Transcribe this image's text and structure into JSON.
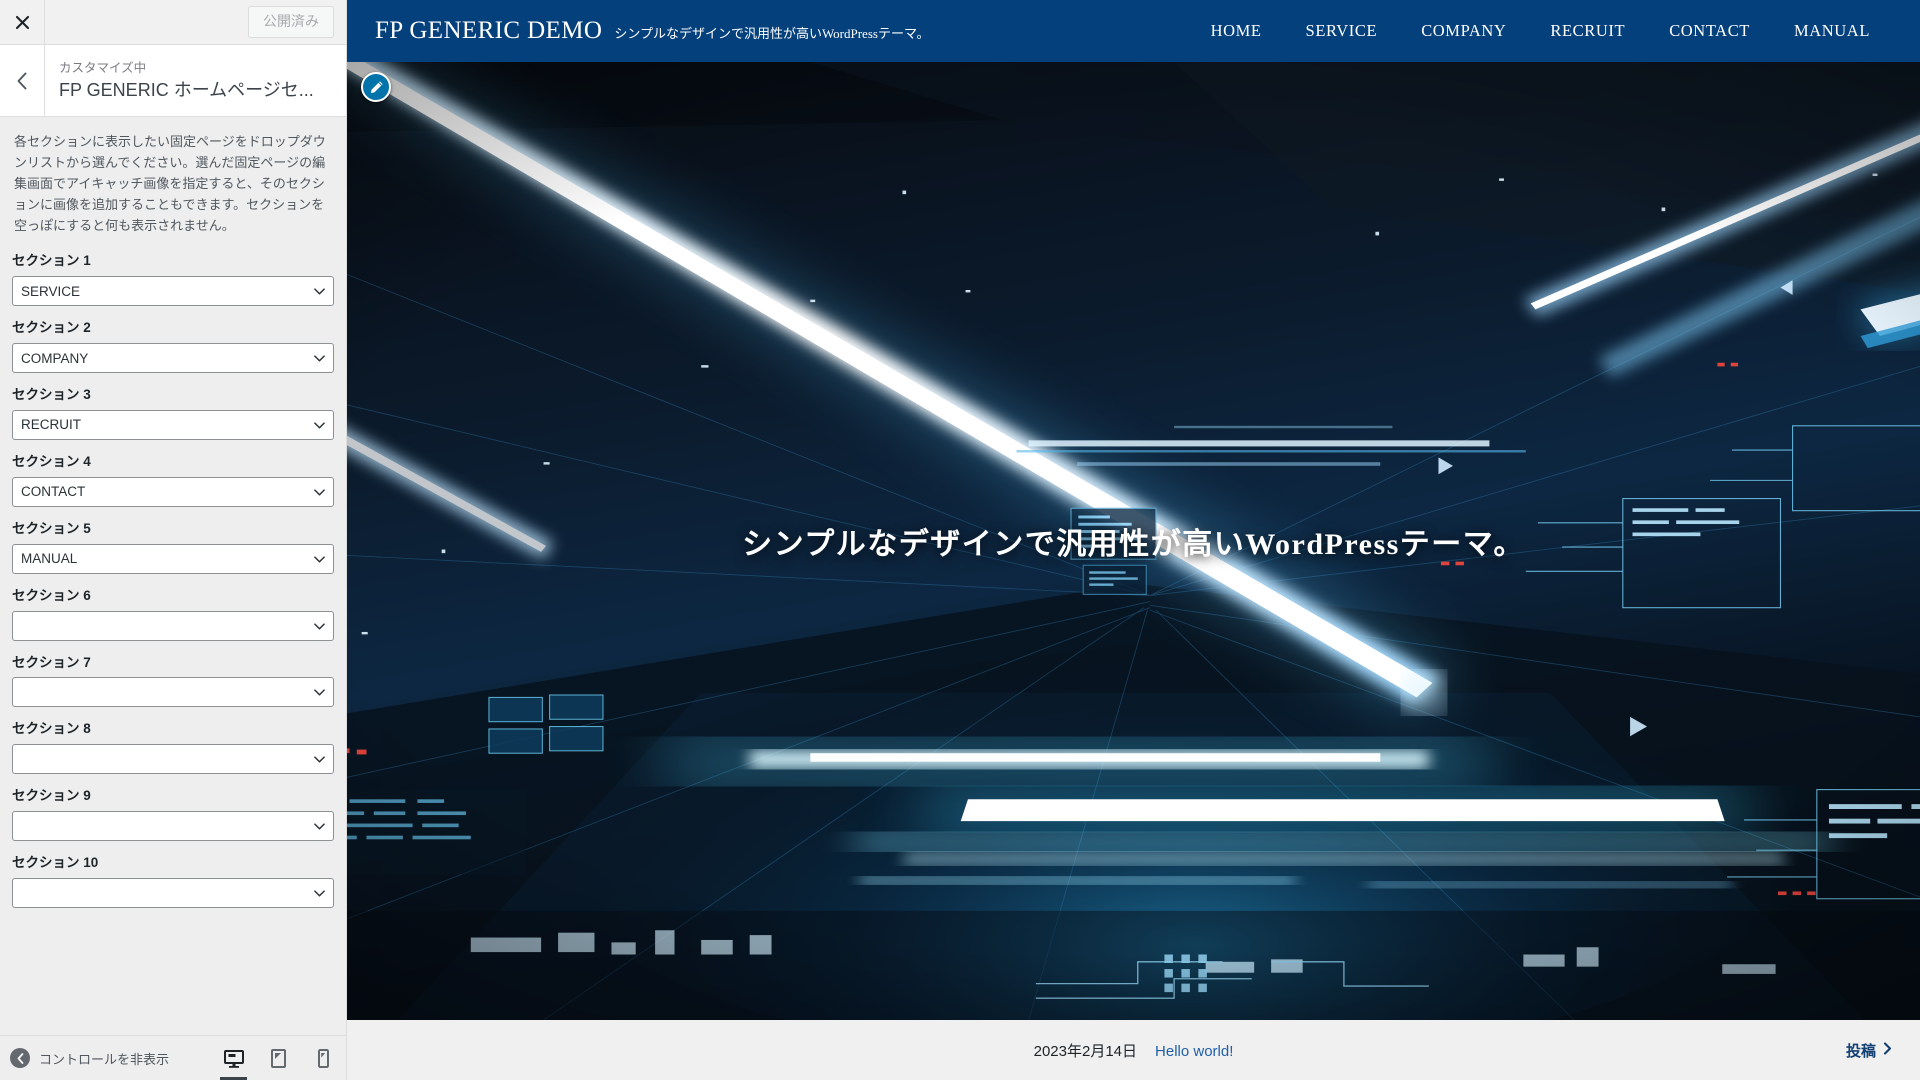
{
  "customizer": {
    "close_icon": "close-icon",
    "publish_label": "公開済み",
    "back_icon": "chevron-left-icon",
    "eyebrow": "カスタマイズ中",
    "panel_name": "FP GENERIC ホームページセ...",
    "description": "各セクションに表示したい固定ページをドロップダウンリストから選んでください。選んだ固定ページの編集画面でアイキャッチ画像を指定すると、そのセクションに画像を追加することもできます。セクションを空っぽにすると何も表示されません。",
    "sections": [
      {
        "label": "セクション 1",
        "value": "SERVICE"
      },
      {
        "label": "セクション 2",
        "value": "COMPANY"
      },
      {
        "label": "セクション 3",
        "value": "RECRUIT"
      },
      {
        "label": "セクション 4",
        "value": "CONTACT"
      },
      {
        "label": "セクション 5",
        "value": "MANUAL"
      },
      {
        "label": "セクション 6",
        "value": ""
      },
      {
        "label": "セクション 7",
        "value": ""
      },
      {
        "label": "セクション 8",
        "value": ""
      },
      {
        "label": "セクション 9",
        "value": ""
      },
      {
        "label": "セクション 10",
        "value": ""
      }
    ],
    "footer": {
      "collapse_label": "コントロールを非表示",
      "collapse_icon": "chevron-left-circle-icon",
      "devices": [
        {
          "name": "desktop",
          "icon": "desktop-icon",
          "active": true
        },
        {
          "name": "tablet",
          "icon": "tablet-icon",
          "active": false
        },
        {
          "name": "mobile",
          "icon": "mobile-icon",
          "active": false
        }
      ]
    }
  },
  "preview": {
    "site": {
      "title": "FP GENERIC DEMO",
      "tagline": "シンプルなデザインで汎用性が高いWordPressテーマ。",
      "header_bg": "#04407c",
      "nav": [
        {
          "label": "HOME"
        },
        {
          "label": "SERVICE"
        },
        {
          "label": "COMPANY"
        },
        {
          "label": "RECRUIT"
        },
        {
          "label": "CONTACT"
        },
        {
          "label": "MANUAL"
        }
      ]
    },
    "edit_shortcut_icon": "pencil-icon",
    "hero": {
      "heading": "シンプルなデザインで汎用性が高いWordPressテーマ。",
      "image_description": "dark blue futuristic data-center corridor with glowing light streaks"
    },
    "footer": {
      "post_date": "2023年2月14日",
      "post_title": "Hello world!",
      "more_label": "投稿",
      "more_icon": "chevron-right-icon",
      "link_color": "#1f5fa9"
    }
  }
}
